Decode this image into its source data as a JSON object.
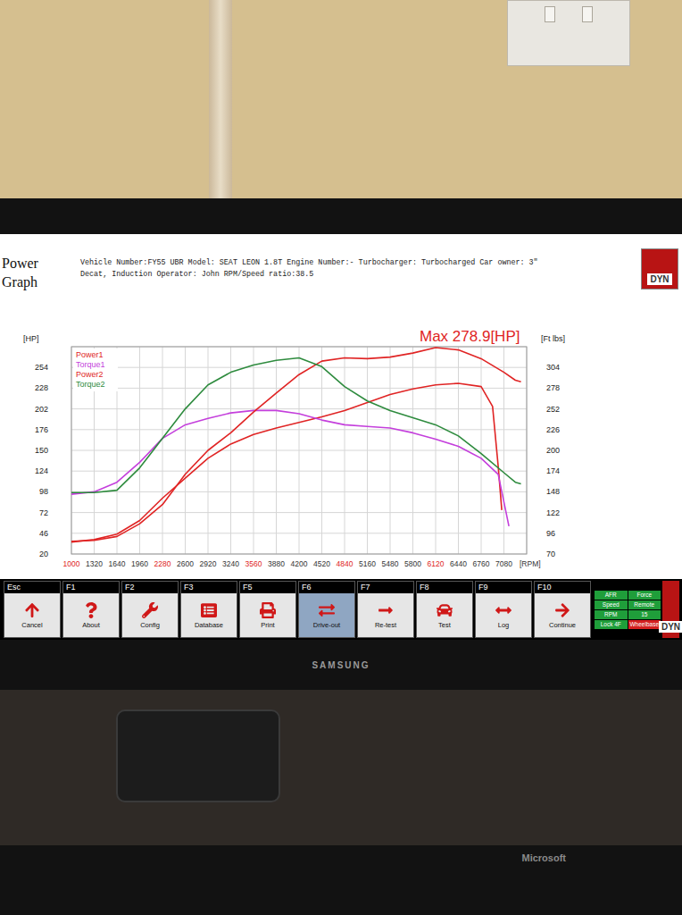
{
  "screen": {
    "title": "Power Graph",
    "info": [
      "Vehicle Number:FY55 UBR Model: SEAT LEON 1.8T Engine Number:- Turbocharger: Turbocharged Car owner: 3\"",
      "Decat, Induction Operator: John RPM/Speed ratio:38.5"
    ],
    "logo": "DYN"
  },
  "chart": {
    "left_axis": {
      "unit": "[HP]",
      "ticks": [
        "254",
        "228",
        "202",
        "176",
        "150",
        "124",
        "98",
        "72",
        "46",
        "20"
      ]
    },
    "right_axis": {
      "unit": "[Ft lbs]",
      "ticks": [
        "304",
        "278",
        "252",
        "226",
        "200",
        "174",
        "148",
        "122",
        "96",
        "70"
      ]
    },
    "x_axis": {
      "unit": "[RPM]",
      "ticks": [
        {
          "label": "1000",
          "highlighted": true
        },
        {
          "label": "1320",
          "highlighted": false
        },
        {
          "label": "1640",
          "highlighted": false
        },
        {
          "label": "1960",
          "highlighted": false
        },
        {
          "label": "2280",
          "highlighted": true
        },
        {
          "label": "2600",
          "highlighted": false
        },
        {
          "label": "2920",
          "highlighted": false
        },
        {
          "label": "3240",
          "highlighted": false
        },
        {
          "label": "3560",
          "highlighted": true
        },
        {
          "label": "3880",
          "highlighted": false
        },
        {
          "label": "4200",
          "highlighted": false
        },
        {
          "label": "4520",
          "highlighted": false
        },
        {
          "label": "4840",
          "highlighted": true
        },
        {
          "label": "5160",
          "highlighted": false
        },
        {
          "label": "5480",
          "highlighted": false
        },
        {
          "label": "5800",
          "highlighted": false
        },
        {
          "label": "6120",
          "highlighted": true
        },
        {
          "label": "6440",
          "highlighted": false
        },
        {
          "label": "6760",
          "highlighted": false
        },
        {
          "label": "7080",
          "highlighted": false
        }
      ]
    },
    "annotation": "Max 278.9[HP]",
    "series": [
      {
        "name": "Power1",
        "color": "#e02424",
        "axis": "left",
        "rpm": [
          1000,
          1320,
          1640,
          1960,
          2280,
          2600,
          2920,
          3240,
          3560,
          3880,
          4200,
          4520,
          4840,
          5160,
          5480,
          5800,
          6120,
          6440,
          6760,
          6920,
          7000,
          7050
        ],
        "values": [
          35,
          38,
          45,
          62,
          90,
          115,
          140,
          158,
          170,
          178,
          185,
          192,
          200,
          210,
          220,
          227,
          232,
          234,
          230,
          205,
          130,
          75
        ]
      },
      {
        "name": "Torque1",
        "color": "#c43fdc",
        "axis": "right",
        "rpm": [
          1000,
          1320,
          1640,
          1960,
          2280,
          2600,
          2920,
          3240,
          3560,
          3880,
          4200,
          4520,
          4840,
          5160,
          5480,
          5800,
          6120,
          6440,
          6760,
          7000,
          7150
        ],
        "values": [
          145,
          148,
          160,
          185,
          215,
          232,
          240,
          247,
          250,
          250,
          246,
          238,
          232,
          230,
          228,
          222,
          214,
          205,
          190,
          170,
          105
        ]
      },
      {
        "name": "Power2",
        "color": "#e02424",
        "axis": "left",
        "rpm": [
          1000,
          1320,
          1640,
          1960,
          2280,
          2600,
          2920,
          3240,
          3560,
          3880,
          4200,
          4520,
          4840,
          5160,
          5480,
          5800,
          6120,
          6440,
          6760,
          7080,
          7240,
          7320
        ],
        "values": [
          36,
          37,
          42,
          58,
          82,
          120,
          150,
          172,
          198,
          222,
          245,
          262,
          266,
          265,
          267,
          272,
          278.9,
          276,
          265,
          248,
          238,
          236
        ]
      },
      {
        "name": "Torque2",
        "color": "#2e8b3e",
        "axis": "right",
        "rpm": [
          1000,
          1320,
          1640,
          1960,
          2280,
          2600,
          2920,
          3240,
          3560,
          3880,
          4200,
          4520,
          4840,
          5160,
          5480,
          5800,
          6120,
          6440,
          6760,
          7080,
          7240,
          7320
        ],
        "values": [
          147,
          147,
          150,
          178,
          215,
          252,
          282,
          298,
          307,
          313,
          316,
          305,
          280,
          262,
          250,
          241,
          232,
          218,
          196,
          172,
          160,
          158
        ]
      }
    ]
  },
  "toolbar": {
    "keys": [
      {
        "key": "Esc",
        "label": "Cancel",
        "selected": false
      },
      {
        "key": "F1",
        "label": "About",
        "selected": false
      },
      {
        "key": "F2",
        "label": "Config",
        "selected": false
      },
      {
        "key": "F3",
        "label": "Database",
        "selected": false
      },
      {
        "key": "F5",
        "label": "Print",
        "selected": false
      },
      {
        "key": "F6",
        "label": "Drive-out",
        "selected": true
      },
      {
        "key": "F7",
        "label": "Re-test",
        "selected": false
      },
      {
        "key": "F8",
        "label": "Test",
        "selected": false
      },
      {
        "key": "F9",
        "label": "Log",
        "selected": false
      },
      {
        "key": "F10",
        "label": "Continue",
        "selected": false
      }
    ],
    "indicators": [
      {
        "label": "AFR",
        "color": "#1f9e3a"
      },
      {
        "label": "Force",
        "color": "#1f9e3a"
      },
      {
        "label": "Speed",
        "color": "#1f9e3a"
      },
      {
        "label": "Remote",
        "color": "#1f9e3a"
      },
      {
        "label": "RPM",
        "color": "#1f9e3a"
      },
      {
        "label": "15",
        "color": "#1f9e3a"
      },
      {
        "label": "Lock 4F",
        "color": "#1f9e3a"
      },
      {
        "label": "Wheelbase",
        "color": "#d42020"
      }
    ],
    "logo": "DYN"
  },
  "monitor": {
    "brand": "SAMSUNG"
  },
  "keyboard": {
    "brand": "Microsoft"
  }
}
